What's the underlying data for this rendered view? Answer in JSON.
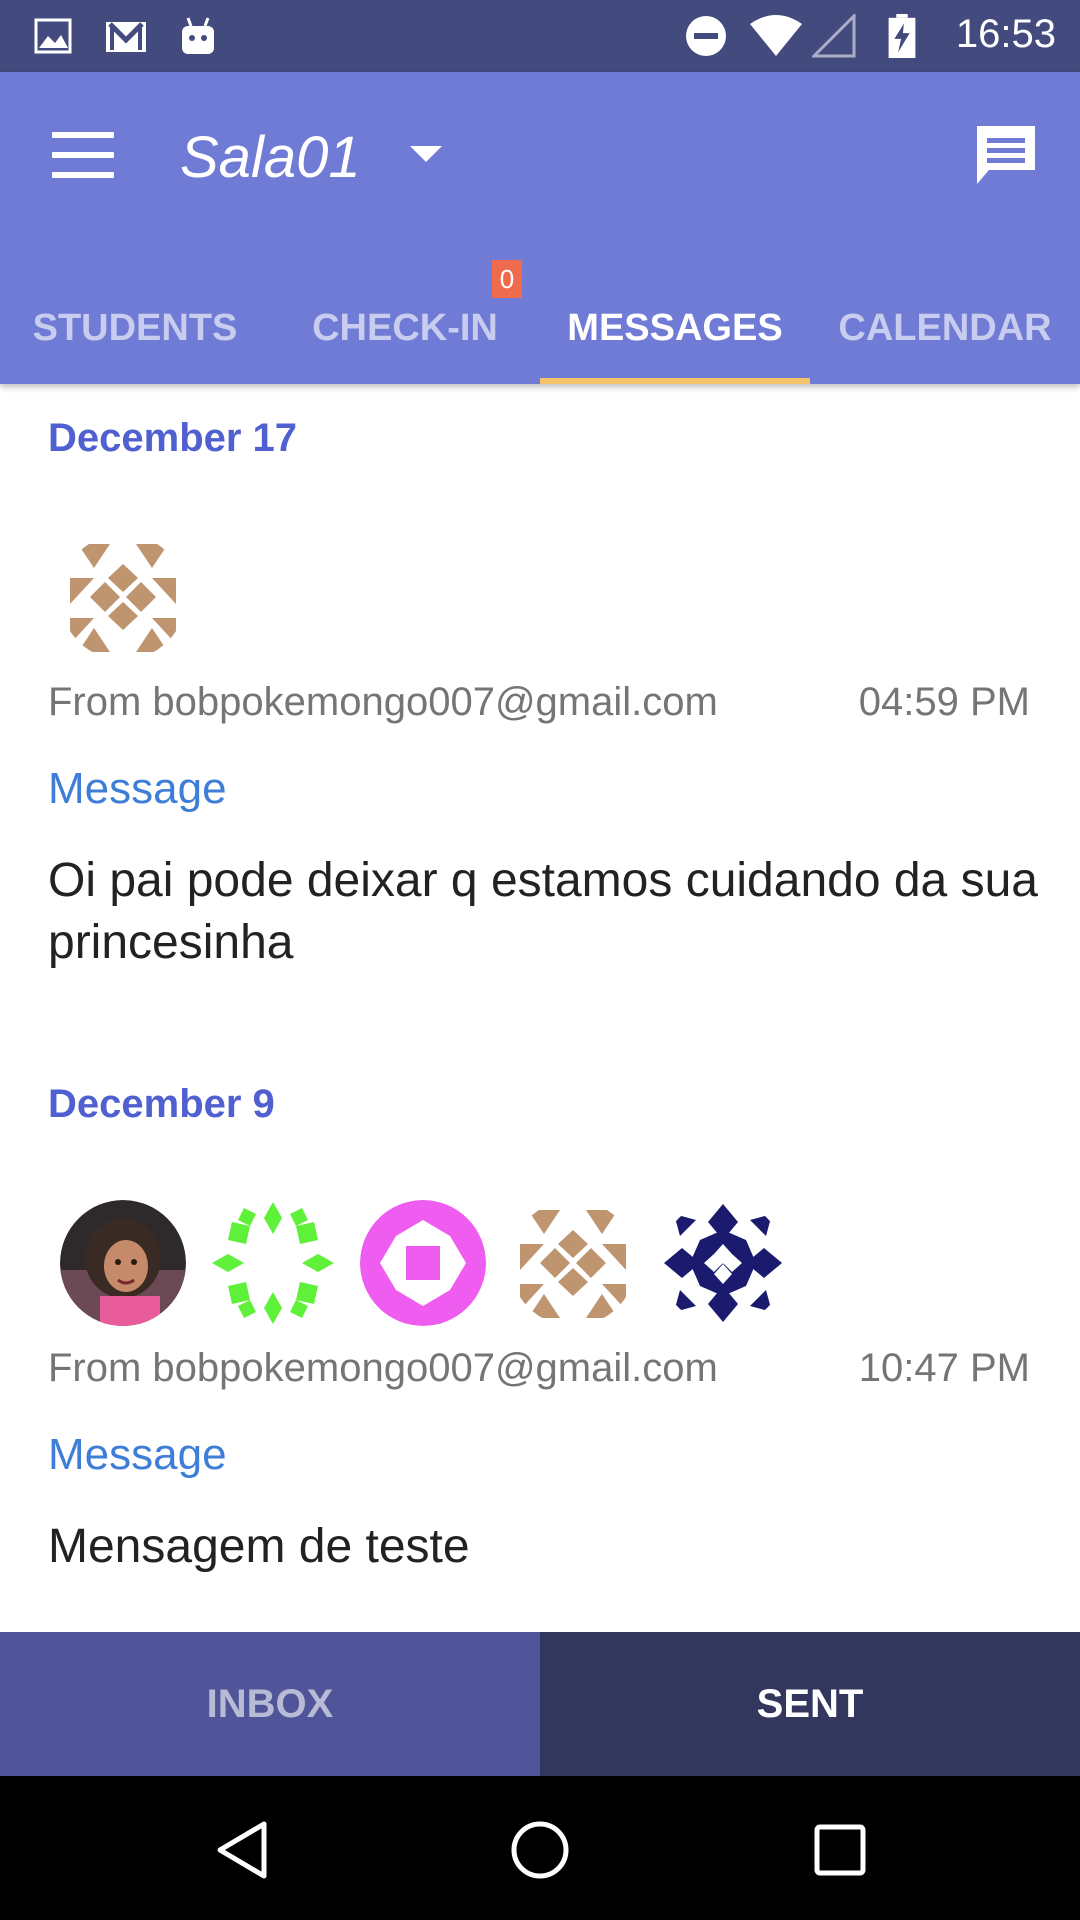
{
  "status_bar": {
    "time": "16:53",
    "left_icons": [
      "image-icon",
      "gmail-icon",
      "android-icon"
    ],
    "right_icons": [
      "dnd-icon",
      "wifi-icon",
      "signal-icon",
      "battery-charging-icon"
    ]
  },
  "app_bar": {
    "room_title": "Sala01",
    "menu_icon": "hamburger-icon",
    "compose_icon": "chat-message-icon"
  },
  "tabs": [
    {
      "label": "STUDENTS",
      "active": false
    },
    {
      "label": "CHECK-IN",
      "active": false,
      "badge": "0"
    },
    {
      "label": "MESSAGES",
      "active": true
    },
    {
      "label": "CALENDAR",
      "active": false
    }
  ],
  "messages": [
    {
      "date": "December 17",
      "from": "From bobpokemongo007@gmail.com",
      "time": "04:59 PM",
      "label": "Message",
      "body": "Oi pai pode deixar q estamos cuidando da sua princesinha"
    },
    {
      "date": "December 9",
      "from": "From bobpokemongo007@gmail.com",
      "time": "10:47 PM",
      "label": "Message",
      "body": "Mensagem de teste"
    }
  ],
  "bottom_tabs": [
    {
      "label": "INBOX",
      "active": false
    },
    {
      "label": "SENT",
      "active": true
    }
  ],
  "colors": {
    "status_bar": "#434a7e",
    "app_bar": "#6f7bd4",
    "tab_indicator": "#f2c36b",
    "badge": "#ee6c4d",
    "date_header": "#5160d0",
    "message_label": "#3f7ed8",
    "inbox_bg": "#4f5598",
    "sent_bg": "#33375e"
  }
}
